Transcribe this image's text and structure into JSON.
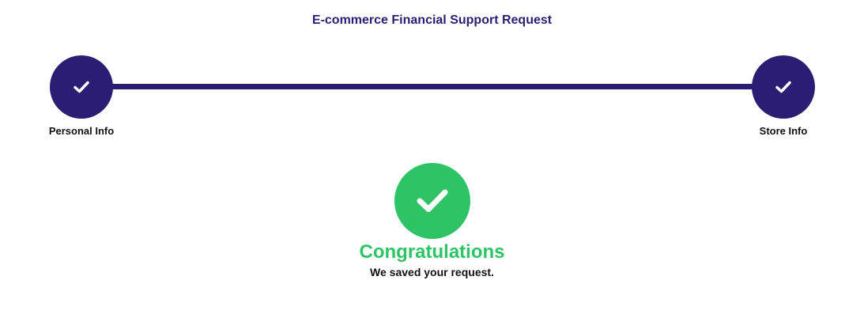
{
  "form": {
    "title": "E-commerce Financial Support Request"
  },
  "steps": [
    {
      "label": "Personal Info",
      "status": "completed",
      "icon": "check-icon"
    },
    {
      "label": "Store Info",
      "status": "completed",
      "icon": "check-icon"
    }
  ],
  "success": {
    "icon": "check-circle-icon",
    "title": "Congratulations",
    "message": "We saved your request."
  },
  "colors": {
    "primary": "#2b1d74",
    "success": "#2ec466",
    "text": "#111111",
    "background": "#ffffff"
  }
}
